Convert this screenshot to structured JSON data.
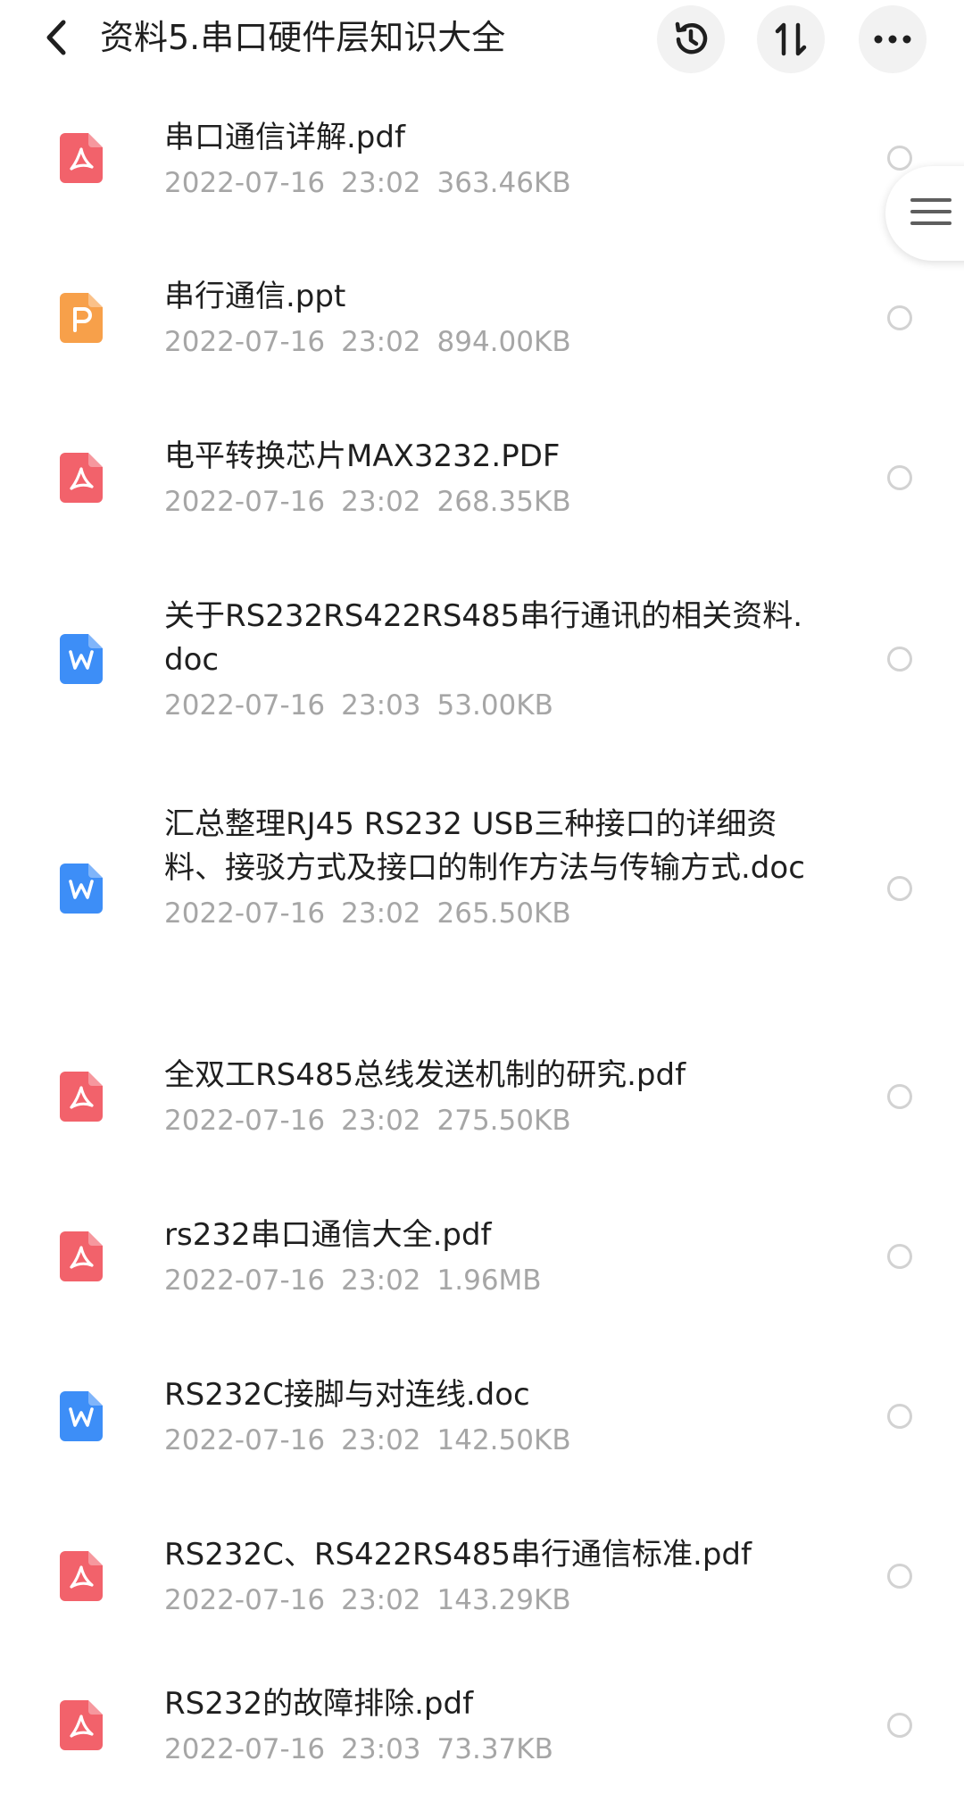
{
  "header": {
    "title": "资料5.串口硬件层知识大全",
    "back_icon": "chevron-left-icon",
    "history_icon": "history-clock-icon",
    "sort_icon": "sort-arrows-icon",
    "more_icon": "more-dots-icon"
  },
  "colors": {
    "pdf": "#f2626b",
    "ppt": "#f7a04a",
    "doc": "#3d8ef7",
    "meta_text": "#a6a6a6",
    "title_text": "#1f1f1f"
  },
  "files": [
    {
      "name": "串口通信详解.pdf",
      "date": "2022-07-16",
      "time": "23:02",
      "size": "363.46KB",
      "type": "pdf"
    },
    {
      "name": "串行通信.ppt",
      "date": "2022-07-16",
      "time": "23:02",
      "size": "894.00KB",
      "type": "ppt"
    },
    {
      "name": "电平转换芯片MAX3232.PDF",
      "date": "2022-07-16",
      "time": "23:02",
      "size": "268.35KB",
      "type": "pdf"
    },
    {
      "name": "关于RS232RS422RS485串行通讯的相关资料.doc",
      "date": "2022-07-16",
      "time": "23:03",
      "size": "53.00KB",
      "type": "doc"
    },
    {
      "name": "汇总整理RJ45 RS232 USB三种接口的详细资料、接驳方式及接口的制作方法与传输方式.doc",
      "date": "2022-07-16",
      "time": "23:02",
      "size": "265.50KB",
      "type": "doc"
    },
    {
      "name": "全双工RS485总线发送机制的研究.pdf",
      "date": "2022-07-16",
      "time": "23:02",
      "size": "275.50KB",
      "type": "pdf"
    },
    {
      "name": "rs232串口通信大全.pdf",
      "date": "2022-07-16",
      "time": "23:02",
      "size": "1.96MB",
      "type": "pdf"
    },
    {
      "name": "RS232C接脚与对连线.doc",
      "date": "2022-07-16",
      "time": "23:02",
      "size": "142.50KB",
      "type": "doc"
    },
    {
      "name": "RS232C、RS422RS485串行通信标准.pdf",
      "date": "2022-07-16",
      "time": "23:02",
      "size": "143.29KB",
      "type": "pdf"
    },
    {
      "name": "RS232的故障排除.pdf",
      "date": "2022-07-16",
      "time": "23:03",
      "size": "73.37KB",
      "type": "pdf"
    }
  ],
  "side_handle": {
    "icon": "menu-lines-icon"
  }
}
